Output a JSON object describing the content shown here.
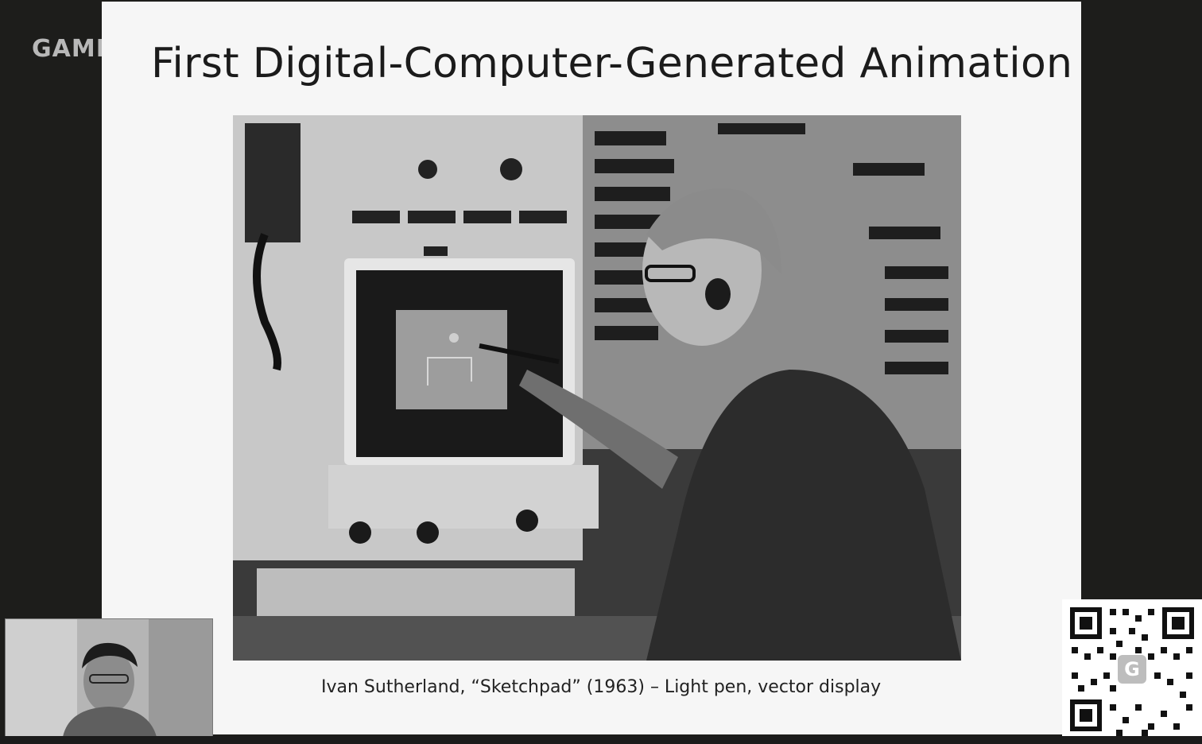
{
  "overlay": {
    "brand_text": "GAME"
  },
  "slide": {
    "title": "First Digital-Computer-Generated Animation",
    "photo_subject": "",
    "caption": "Ivan Sutherland, “Sketchpad” (1963) – Light pen, vector display"
  },
  "webcam": {
    "icon": "presenter-video-icon"
  },
  "qr": {
    "icon": "qr-code-icon"
  },
  "colors": {
    "slide_background": "#f6f6f6",
    "page_background": "#1d1d1b",
    "title_text": "#1b1b1b"
  }
}
